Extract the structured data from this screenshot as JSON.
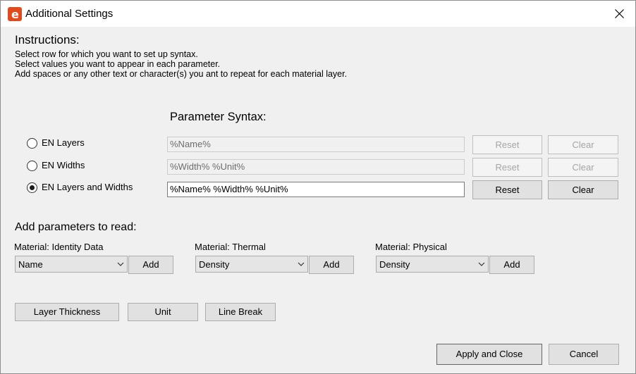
{
  "window": {
    "title": "Additional Settings",
    "app_icon_letter": "e"
  },
  "instructions": {
    "heading": "Instructions:",
    "lines": [
      "Select row for which you want to set up syntax.",
      "Select values you want to appear in each parameter.",
      "Add spaces or any other text or character(s) you ant to repeat for each material layer."
    ]
  },
  "syntax": {
    "heading": "Parameter Syntax:",
    "rows": [
      {
        "option": "EN Layers",
        "selected": false,
        "value": "%Name%",
        "reset": "Reset",
        "clear": "Clear",
        "enabled": false
      },
      {
        "option": "EN Widths",
        "selected": false,
        "value": "%Width% %Unit%",
        "reset": "Reset",
        "clear": "Clear",
        "enabled": false
      },
      {
        "option": "EN Layers and Widths",
        "selected": true,
        "value": "%Name% %Width% %Unit%",
        "reset": "Reset",
        "clear": "Clear",
        "enabled": true
      }
    ]
  },
  "add_params": {
    "heading": "Add parameters to read:",
    "groups": [
      {
        "label": "Material: Identity Data",
        "selected": "Name",
        "add": "Add"
      },
      {
        "label": "Material: Thermal",
        "selected": "Density",
        "add": "Add"
      },
      {
        "label": "Material: Physical",
        "selected": "Density",
        "add": "Add"
      }
    ],
    "extra_buttons": [
      "Layer Thickness",
      "Unit",
      "Line Break"
    ]
  },
  "footer": {
    "apply": "Apply and Close",
    "cancel": "Cancel"
  }
}
